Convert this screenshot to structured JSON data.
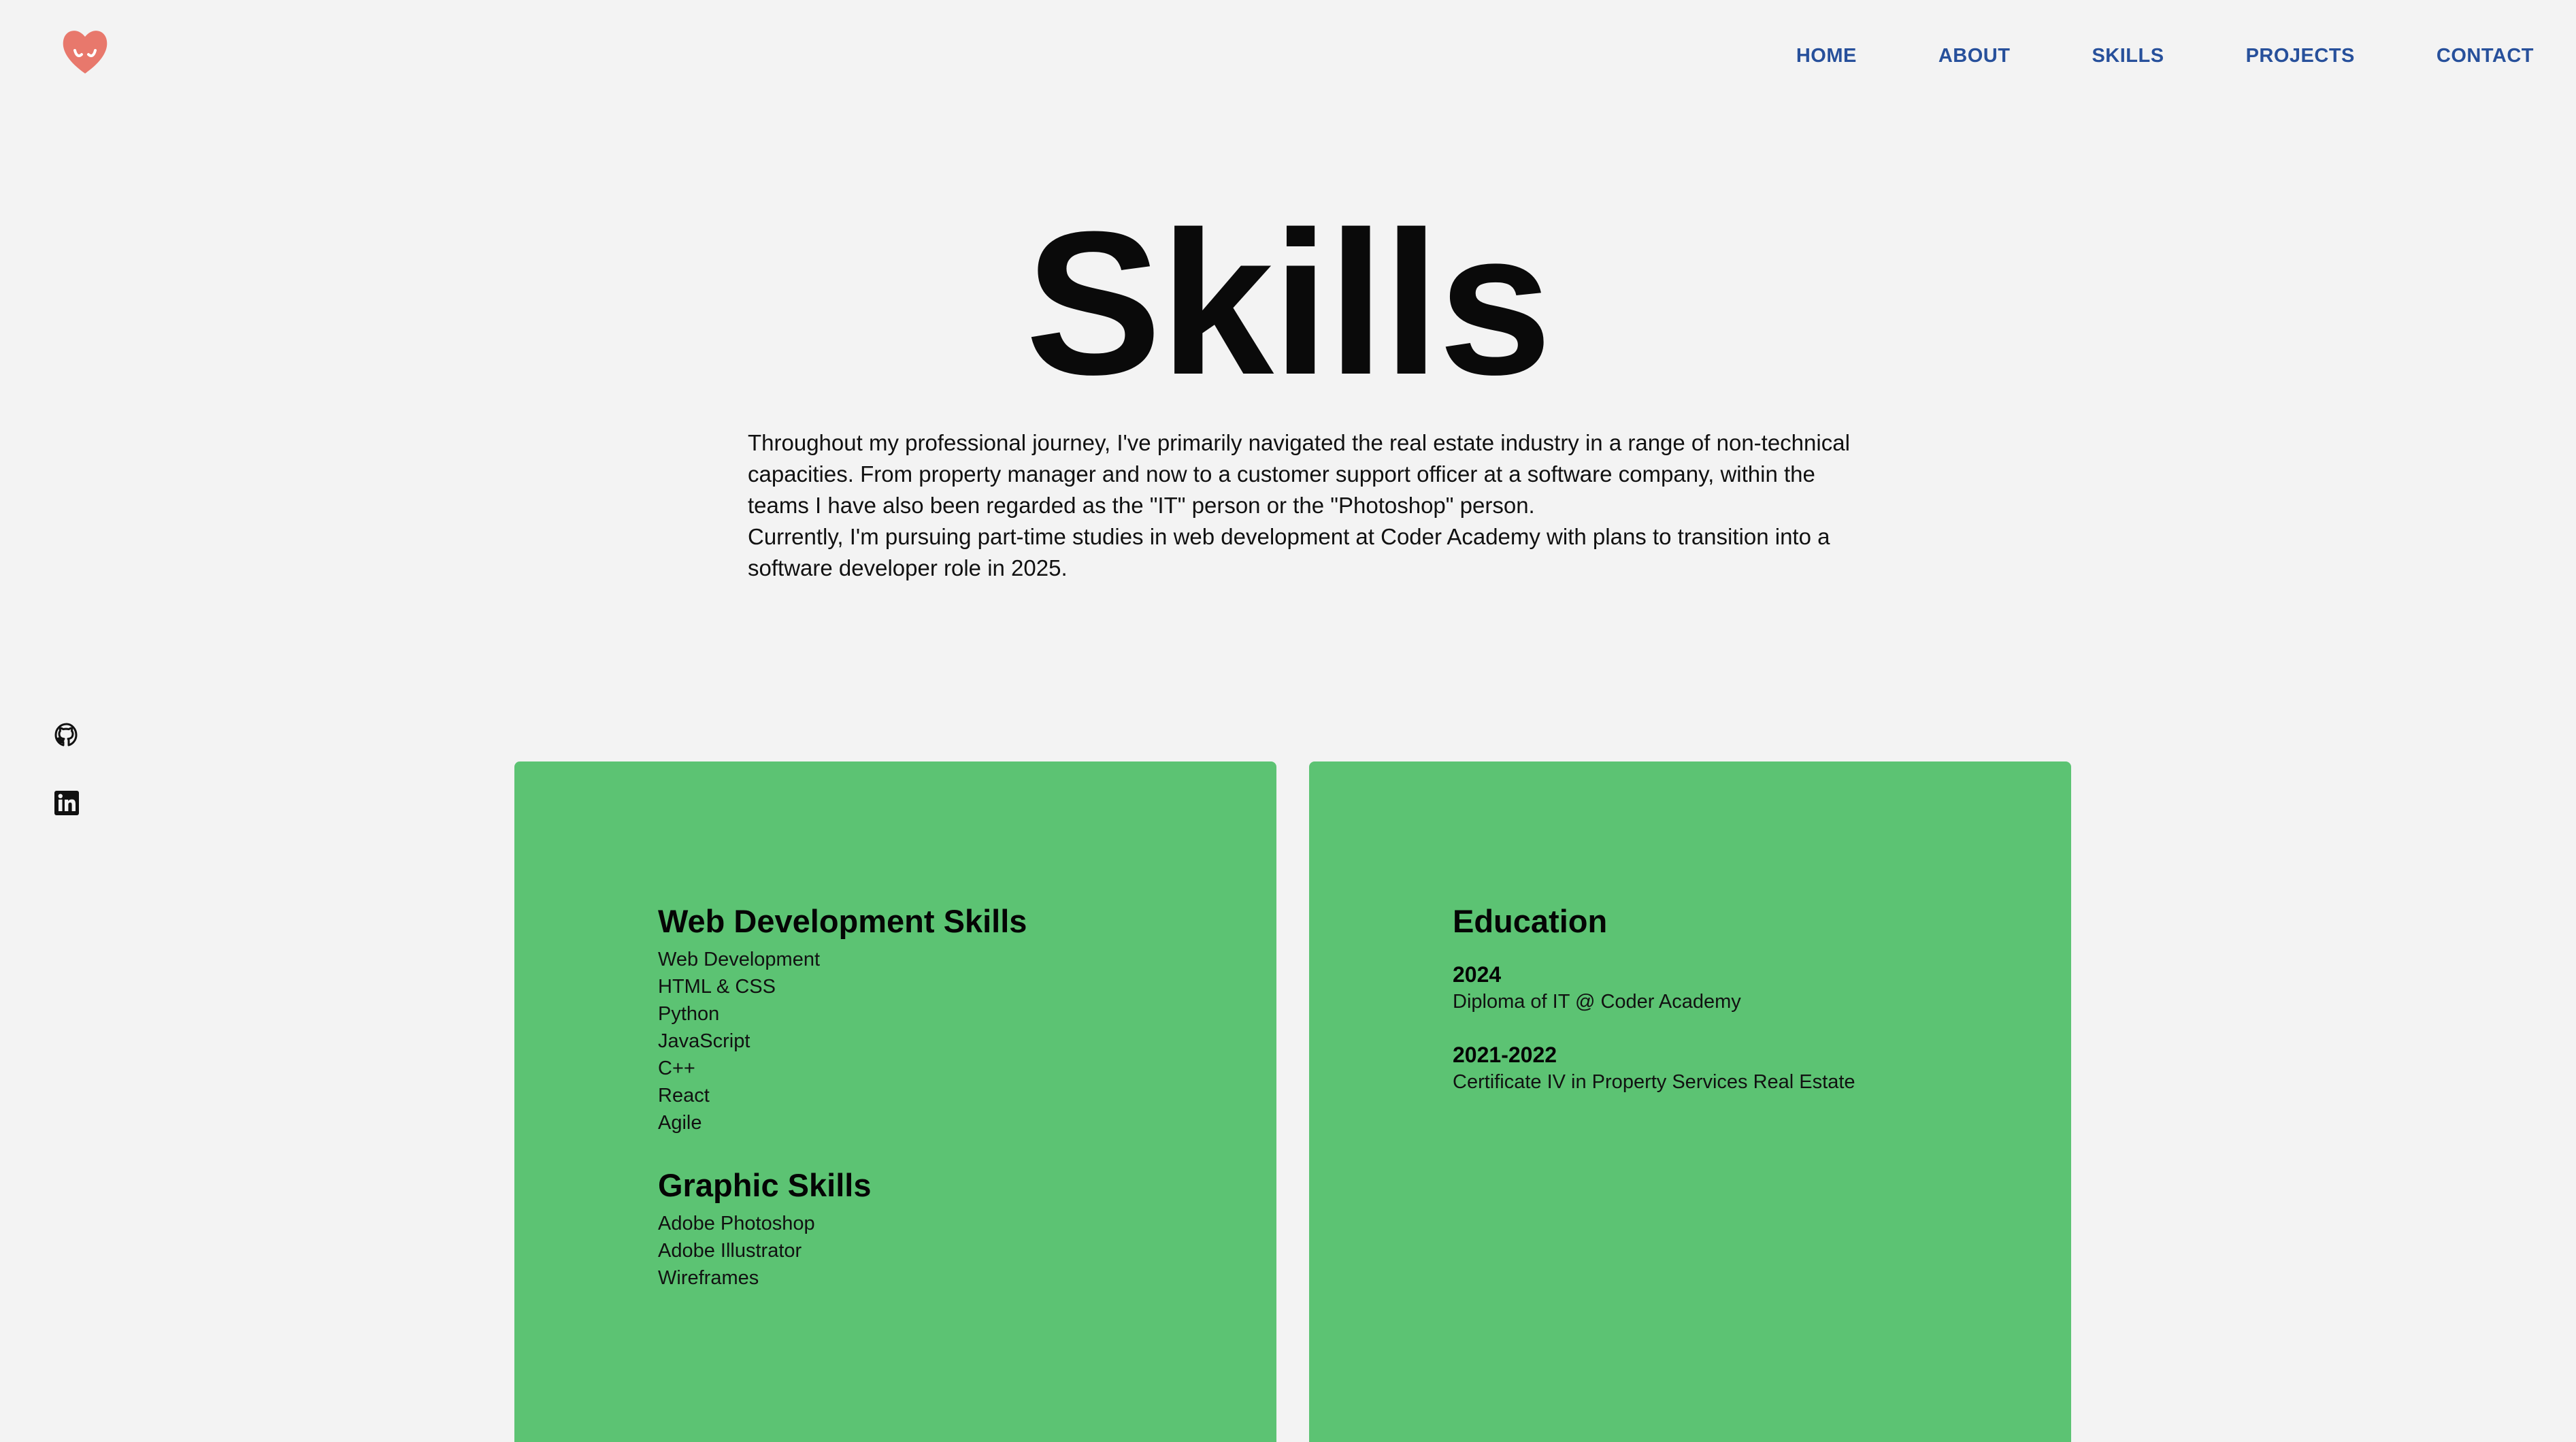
{
  "header": {
    "logo_icon": "heart-smile-logo-icon",
    "accent_color": "#e8786c",
    "nav": [
      {
        "label": "HOME"
      },
      {
        "label": "ABOUT"
      },
      {
        "label": "SKILLS"
      },
      {
        "label": "PROJECTS"
      },
      {
        "label": "CONTACT"
      }
    ],
    "nav_color": "#27509b"
  },
  "social": [
    {
      "icon": "github-icon"
    },
    {
      "icon": "linkedin-icon"
    }
  ],
  "hero": {
    "title": "Skills",
    "intro_paragraphs": [
      "Throughout my professional journey, I've primarily navigated the real estate industry in a range of non-technical capacities. From property manager and now to a customer support officer at a software company, within the teams I have also been regarded as the \"IT\" person or the \"Photoshop\" person.",
      "Currently, I'm pursuing part-time studies in web development at Coder Academy with plans to transition into a software developer role in 2025."
    ]
  },
  "cards": {
    "background_color": "#5cc373",
    "skills": {
      "web_title": "Web Development Skills",
      "web_items": [
        "Web Development",
        "HTML & CSS",
        "Python",
        "JavaScript",
        "C++",
        "React",
        "Agile"
      ],
      "graphic_title": "Graphic Skills",
      "graphic_items": [
        "Adobe Photoshop",
        "Adobe Illustrator",
        "Wireframes"
      ]
    },
    "education": {
      "title": "Education",
      "items": [
        {
          "year": "2024",
          "description": "Diploma of IT @ Coder Academy"
        },
        {
          "year": "2021-2022",
          "description": "Certificate IV in Property Services Real Estate"
        }
      ]
    }
  }
}
